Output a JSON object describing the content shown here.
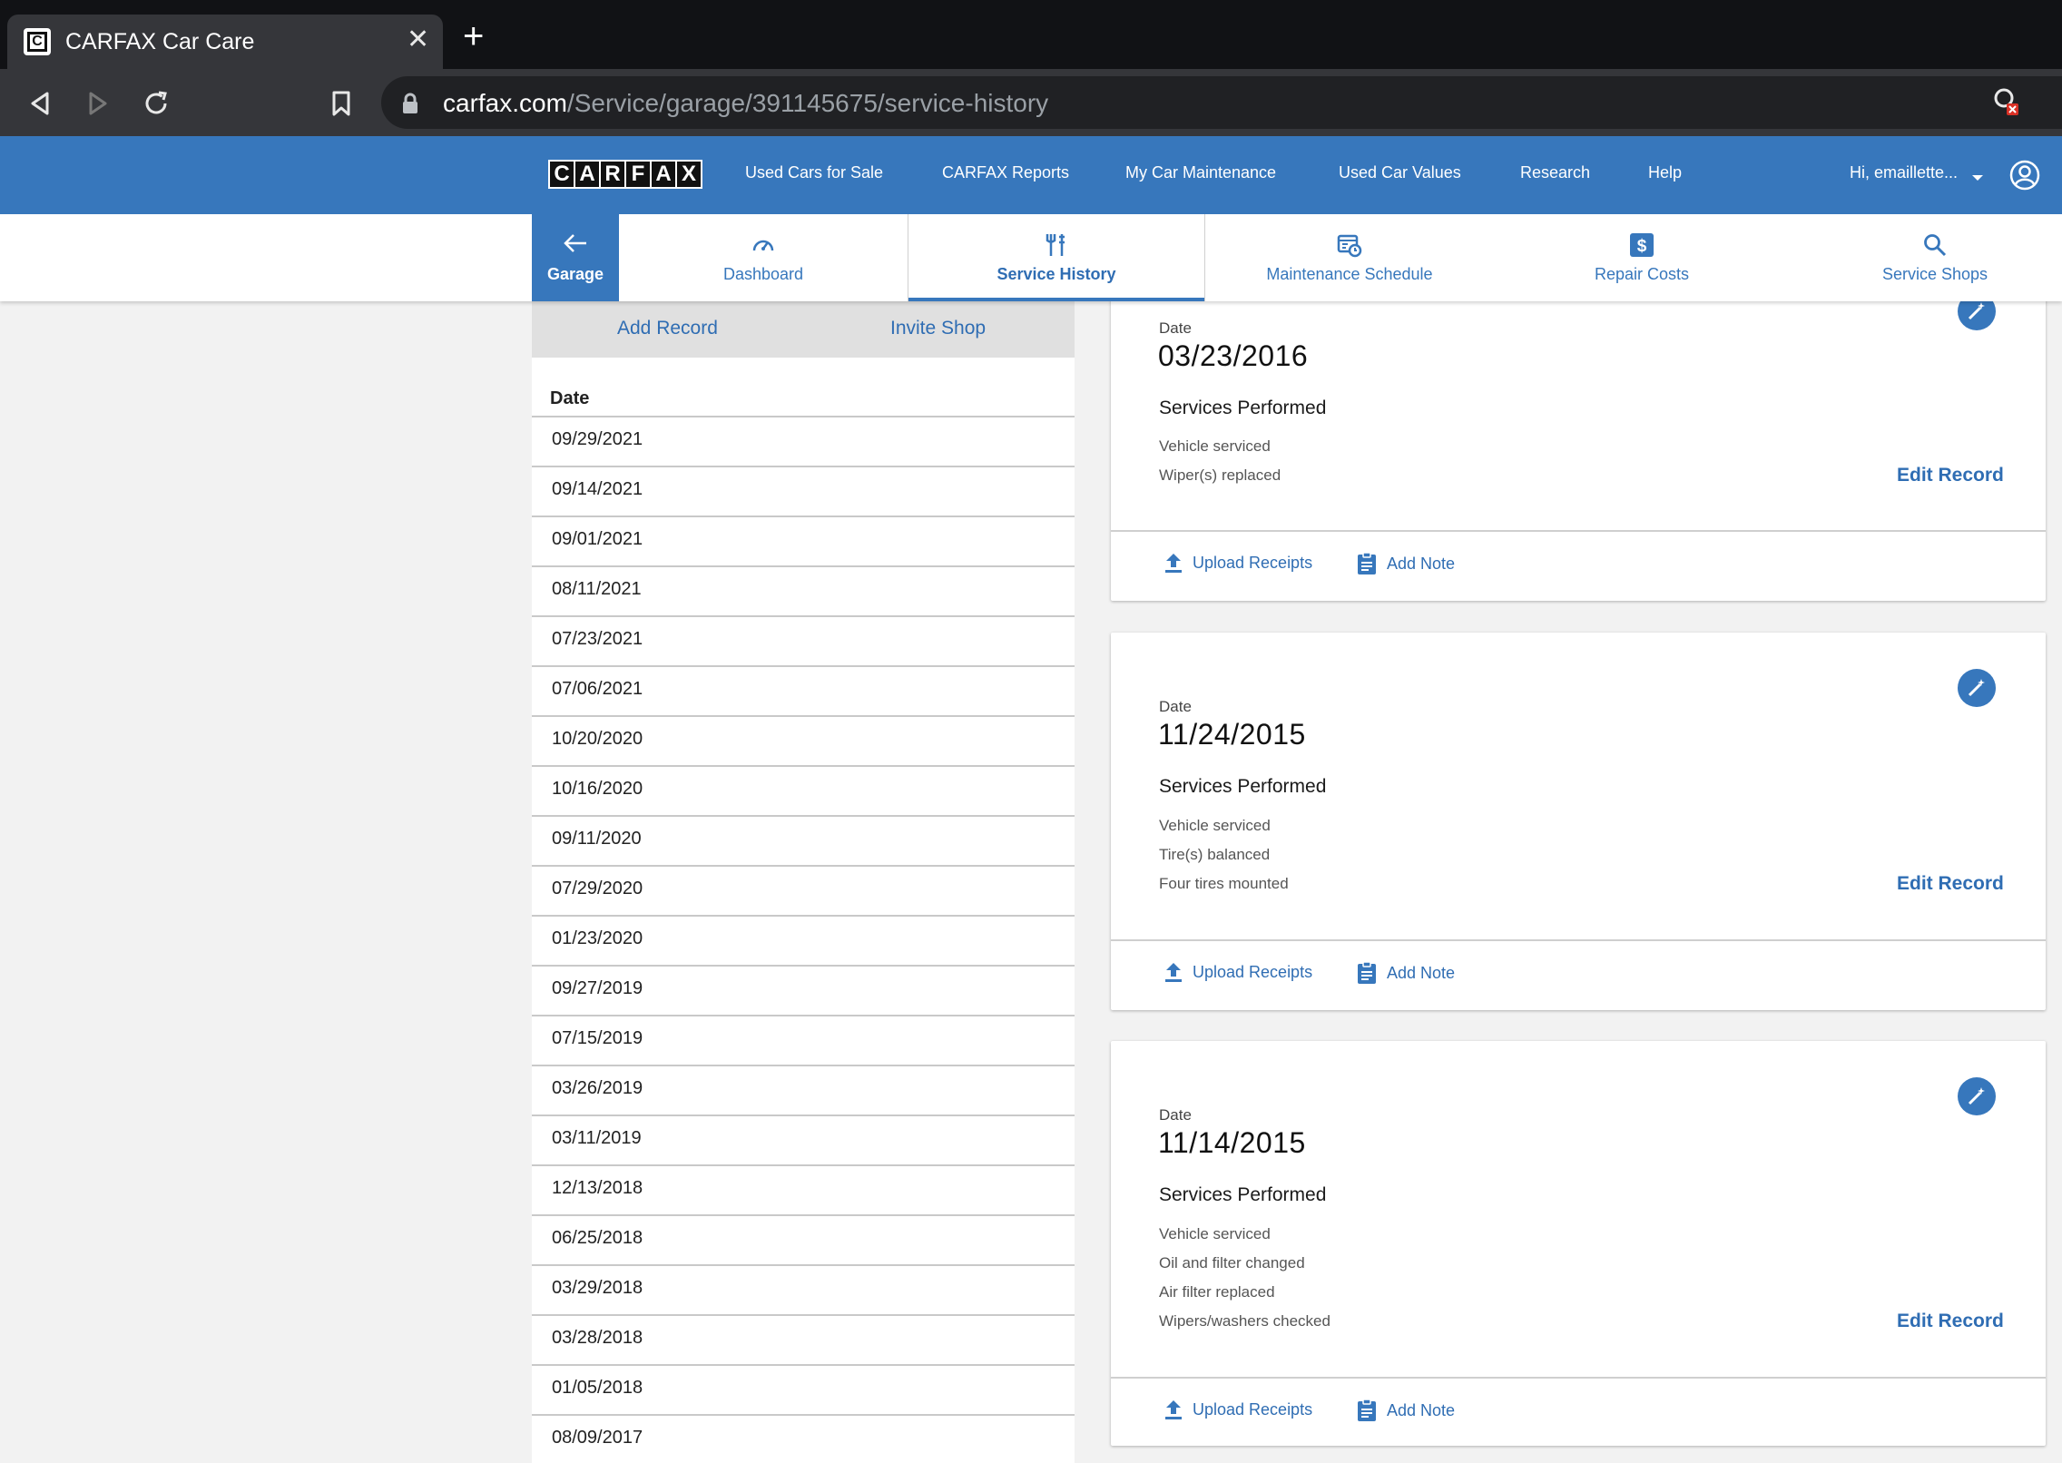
{
  "browser": {
    "tab_title": "CARFAX Car Care",
    "url_domain": "carfax.com",
    "url_path": "/Service/garage/391145675/service-history"
  },
  "header": {
    "logo_letters": [
      "C",
      "A",
      "R",
      "F",
      "A",
      "X"
    ],
    "nav": [
      "Used Cars for Sale",
      "CARFAX Reports",
      "My Car Maintenance",
      "Used Car Values",
      "Research",
      "Help"
    ],
    "user_label": "Hi, emaillette..."
  },
  "subnav": {
    "back_label": "Garage",
    "tabs": [
      "Dashboard",
      "Service History",
      "Maintenance Schedule",
      "Repair Costs",
      "Service Shops"
    ],
    "active": "Service History"
  },
  "left": {
    "add_record": "Add Record",
    "invite_shop": "Invite Shop",
    "column_header": "Date",
    "dates": [
      "09/29/2021",
      "09/14/2021",
      "09/01/2021",
      "08/11/2021",
      "07/23/2021",
      "07/06/2021",
      "10/20/2020",
      "10/16/2020",
      "09/11/2020",
      "07/29/2020",
      "01/23/2020",
      "09/27/2019",
      "07/15/2019",
      "03/26/2019",
      "03/11/2019",
      "12/13/2018",
      "06/25/2018",
      "03/29/2018",
      "03/28/2018",
      "01/05/2018",
      "08/09/2017"
    ]
  },
  "records": [
    {
      "date_label": "Date",
      "date": "03/23/2016",
      "services_title": "Services Performed",
      "services": [
        "Vehicle serviced",
        "Wiper(s) replaced"
      ],
      "edit": "Edit Record",
      "upload": "Upload Receipts",
      "note": "Add Note"
    },
    {
      "date_label": "Date",
      "date": "11/24/2015",
      "services_title": "Services Performed",
      "services": [
        "Vehicle serviced",
        "Tire(s) balanced",
        "Four tires mounted"
      ],
      "edit": "Edit Record",
      "upload": "Upload Receipts",
      "note": "Add Note"
    },
    {
      "date_label": "Date",
      "date": "11/14/2015",
      "services_title": "Services Performed",
      "services": [
        "Vehicle serviced",
        "Oil and filter changed",
        "Air filter replaced",
        "Wipers/washers checked"
      ],
      "edit": "Edit Record",
      "upload": "Upload Receipts",
      "note": "Add Note"
    }
  ],
  "colors": {
    "brand": "#3777bc",
    "link": "#2f6db3",
    "chrome_dark": "#111215",
    "chrome_mid": "#35363a"
  }
}
